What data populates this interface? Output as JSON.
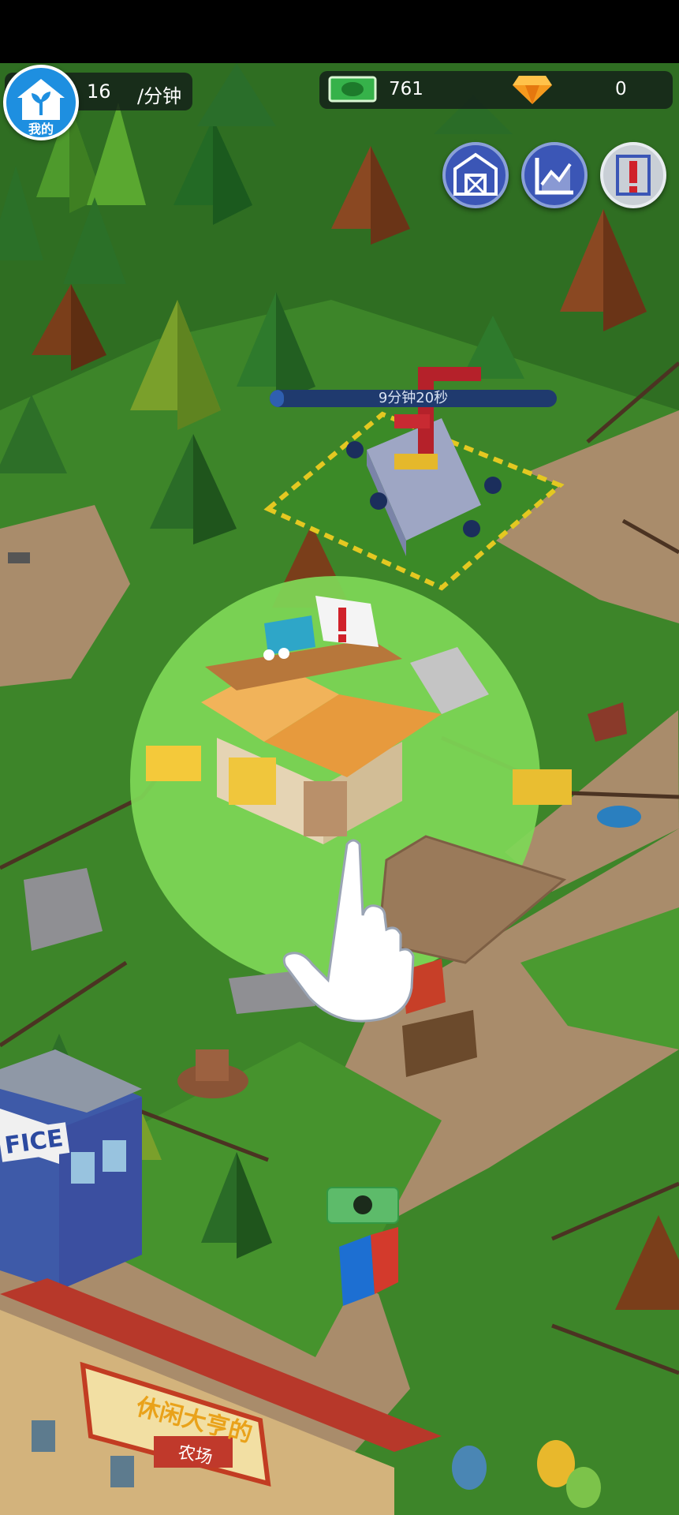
{
  "hud": {
    "income_rate_value": "16",
    "income_rate_unit": "/分钟",
    "profile_label": "我的",
    "cash_amount": "761",
    "gem_amount": "0"
  },
  "construction": {
    "timer_text": "9分钟20秒",
    "progress": 0.05
  },
  "buildings": {
    "office_sign": "FICE",
    "farm_sign_title": "休闲大亨的",
    "farm_sign_subtitle": "农场"
  },
  "colors": {
    "grass": "#3f8a2a",
    "highlight_circle": "#7ed857",
    "dirt_path": "#a98d6c",
    "hud_blue": "#3b56b6",
    "profile_blue": "#1e8fe0"
  },
  "icons": {
    "profile": "sprout-house-icon",
    "cash": "banknote-icon",
    "gem": "diamond-icon",
    "barn_button": "barn-icon",
    "stats_button": "chart-icon",
    "alert_button": "exclamation-icon",
    "tutorial_hand": "pointing-hand-icon"
  }
}
